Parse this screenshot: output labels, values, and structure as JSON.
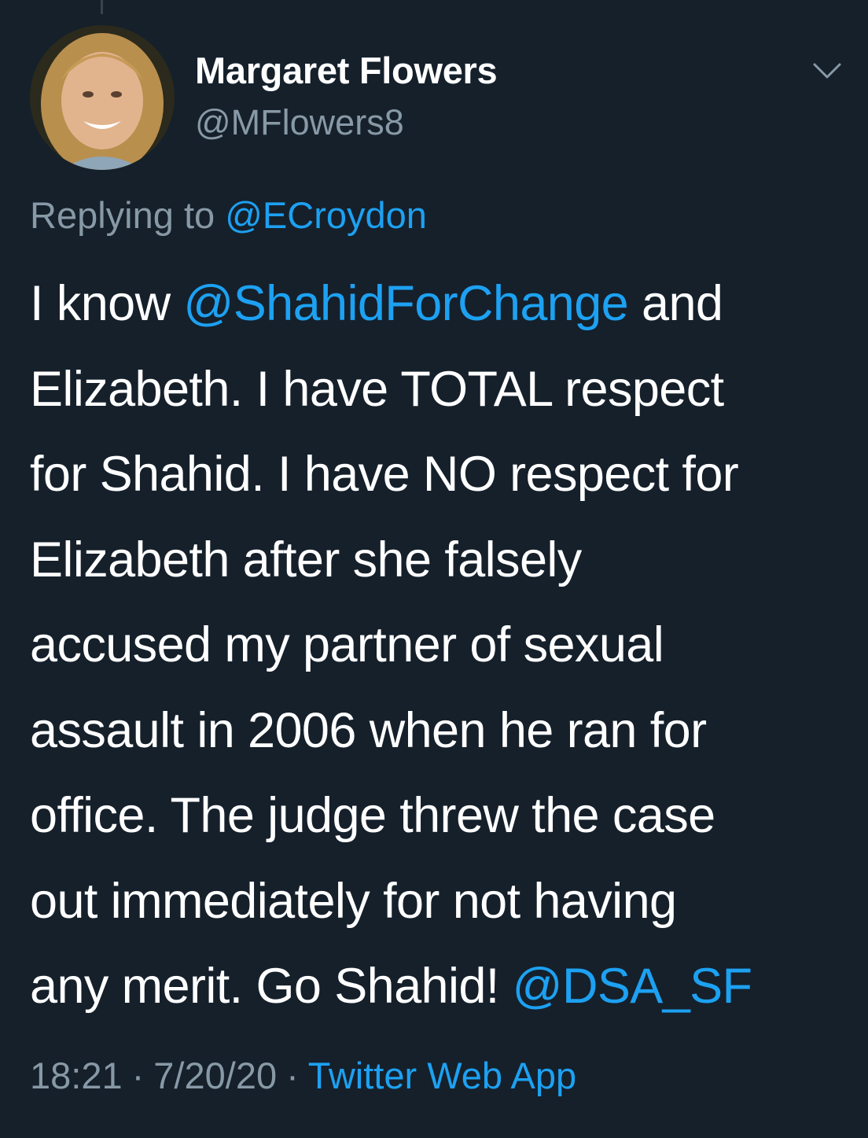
{
  "theme": {
    "background": "#15202b",
    "text_primary": "#ffffff",
    "text_secondary": "#8899a6",
    "link": "#1da1f2"
  },
  "author": {
    "name": "Margaret Flowers",
    "handle": "@MFlowers8",
    "avatar": "avatar-photo"
  },
  "header": {
    "more_icon": "chevron-down-icon"
  },
  "reply": {
    "prefix": "Replying to",
    "to": "@ECroydon"
  },
  "tweet": {
    "line1_pre": "I know",
    "line1_mention": "@ShahidForChange",
    "line1_post": "and",
    "line2": "Elizabeth. I have TOTAL respect",
    "line3": "for Shahid. I have NO respect for",
    "line4": "Elizabeth after she falsely",
    "line5": "accused my partner of sexual",
    "line6": "assault in 2006 when he ran for",
    "line7": "office. The judge threw the case",
    "line8": "out immediately for not having",
    "line9_pre": "any merit. Go Shahid!",
    "line9_mention": "@DSA_SF"
  },
  "meta": {
    "time": "18:21",
    "separator": "·",
    "date": "7/20/20",
    "source": "Twitter Web App"
  }
}
